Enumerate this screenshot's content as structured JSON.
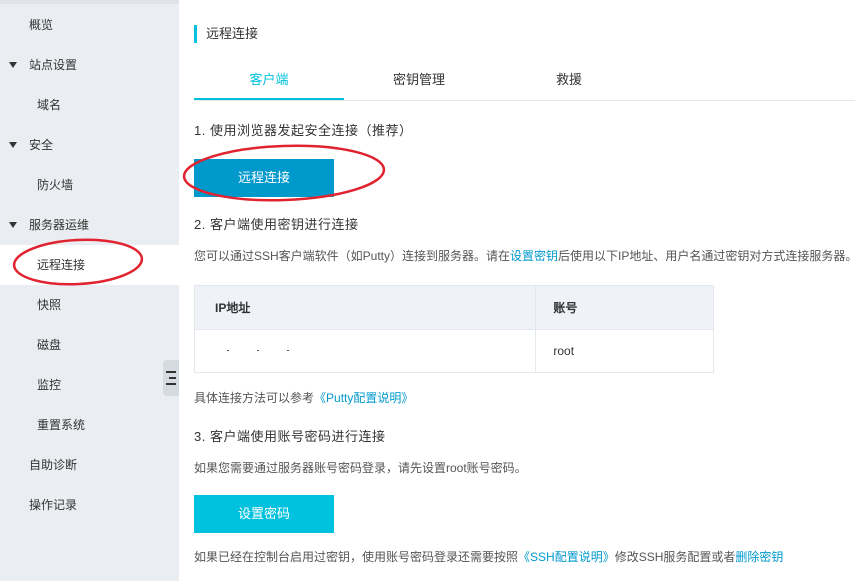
{
  "sidebar": {
    "items": [
      {
        "label": "概览"
      },
      {
        "label": "站点设置"
      },
      {
        "label": "域名"
      },
      {
        "label": "安全"
      },
      {
        "label": "防火墙"
      },
      {
        "label": "服务器运维"
      },
      {
        "label": "远程连接"
      },
      {
        "label": "快照"
      },
      {
        "label": "磁盘"
      },
      {
        "label": "监控"
      },
      {
        "label": "重置系统"
      },
      {
        "label": "自助诊断"
      },
      {
        "label": "操作记录"
      }
    ],
    "active_item": "远程连接"
  },
  "page": {
    "title": "远程连接"
  },
  "tabs": [
    {
      "label": "客户端",
      "active": true
    },
    {
      "label": "密钥管理",
      "active": false
    },
    {
      "label": "救援",
      "active": false
    }
  ],
  "section1": {
    "heading": "1. 使用浏览器发起安全连接（推荐）",
    "button_label": "远程连接"
  },
  "section2": {
    "heading": "2. 客户端使用密钥进行连接",
    "desc_before": "您可以通过SSH客户端软件（如Putty）连接到服务器。请在",
    "desc_link": "设置密钥",
    "desc_after": "后使用以下IP地址、用户名通过密钥对方式连接服务器。",
    "table": {
      "headers": [
        "IP地址",
        "账号"
      ],
      "rows": [
        {
          "ip": "",
          "account": "root"
        }
      ]
    },
    "ref_prefix": "具体连接方法可以参考",
    "ref_link": "《Putty配置说明》"
  },
  "section3": {
    "heading": "3. 客户端使用账号密码进行连接",
    "desc": "如果您需要通过服务器账号密码登录，请先设置root账号密码。",
    "button_label": "设置密码",
    "footer_prefix": "如果已经在控制台启用过密钥，使用账号密码登录还需要按照",
    "footer_link1": "《SSH配置说明》",
    "footer_middle": "修改SSH服务配置或者",
    "footer_link2": "删除密钥"
  },
  "colors": {
    "accent": "#00c1de",
    "primary_button": "#0099cc",
    "link": "#0099cc",
    "sidebar_bg": "#eaedf1",
    "annotation": "#e0232e"
  }
}
